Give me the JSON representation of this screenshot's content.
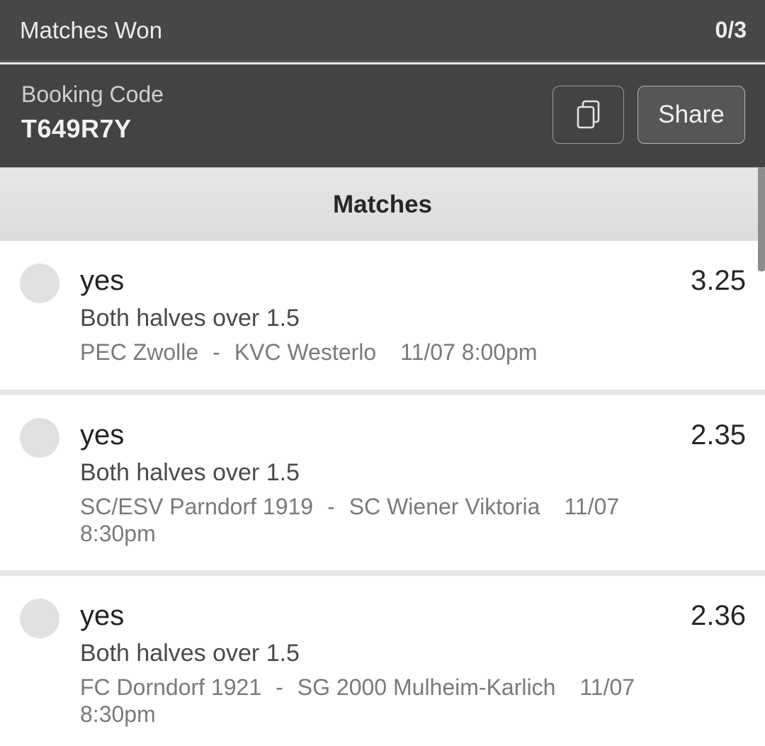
{
  "summary": {
    "label": "Matches Won",
    "value": "0/3"
  },
  "booking": {
    "label": "Booking Code",
    "code": "T649R7Y",
    "share_label": "Share"
  },
  "section": {
    "title": "Matches"
  },
  "matches": [
    {
      "pick": "yes",
      "market": "Both halves over 1.5",
      "home": "PEC Zwolle",
      "separator": "-",
      "away": "KVC Westerlo",
      "datetime": "11/07 8:00pm",
      "odds": "3.25"
    },
    {
      "pick": "yes",
      "market": "Both halves over 1.5",
      "home": "SC/ESV Parndorf 1919",
      "separator": "-",
      "away": "SC Wiener Viktoria",
      "datetime": "11/07 8:30pm",
      "odds": "2.35"
    },
    {
      "pick": "yes",
      "market": "Both halves over 1.5",
      "home": "FC Dorndorf 1921",
      "separator": "-",
      "away": "SG 2000 Mulheim-Karlich",
      "datetime": "11/07 8:30pm",
      "odds": "2.36"
    }
  ],
  "icons": {
    "copy": "copy-icon"
  },
  "colors": {
    "header_bg": "#474747",
    "booking_bg": "#434343",
    "section_bg": "#e0e0e0",
    "card_bg": "#ffffff"
  }
}
